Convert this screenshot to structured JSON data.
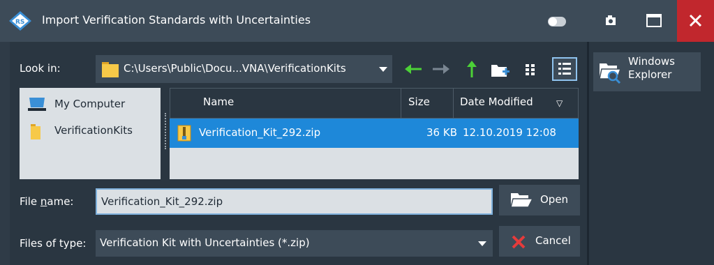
{
  "window": {
    "title": "Import Verification Standards with Uncertainties",
    "icons": [
      "rohde-schwarz-logo-icon",
      "toggle-icon",
      "camera-icon",
      "maximize-icon",
      "close-icon"
    ],
    "close_color": "#c1272d"
  },
  "look_in": {
    "label": "Look in:",
    "value": "C:\\Users\\Public\\Docu...VNA\\VerificationKits"
  },
  "toolbar": {
    "icons": [
      "back-arrow-icon",
      "forward-arrow-icon",
      "up-folder-icon",
      "new-folder-icon",
      "list-view-icon",
      "detail-view-icon"
    ],
    "accent_green": "#4cd137"
  },
  "places": [
    {
      "label": "My Computer",
      "icon": "computer-icon"
    },
    {
      "label": "VerificationKits",
      "icon": "folder-icon"
    }
  ],
  "file_list": {
    "columns": [
      "Name",
      "Size",
      "Date Modified"
    ],
    "sort_indicator": "▽",
    "rows": [
      {
        "name": "Verification_Kit_292.zip",
        "size": "36 KB",
        "date": "12.10.2019 12:08",
        "selected": true
      }
    ],
    "selection_color": "#1e88d9"
  },
  "file_name": {
    "label_prefix": "File ",
    "label_underlined": "n",
    "label_suffix": "ame:",
    "value": "Verification_Kit_292.zip"
  },
  "file_type": {
    "label": "Files of type:",
    "value": "Verification Kit with Uncertainties (*.zip)"
  },
  "buttons": {
    "open": "Open",
    "cancel": "Cancel",
    "explorer_line1": "Windows",
    "explorer_line2": "Explorer"
  }
}
